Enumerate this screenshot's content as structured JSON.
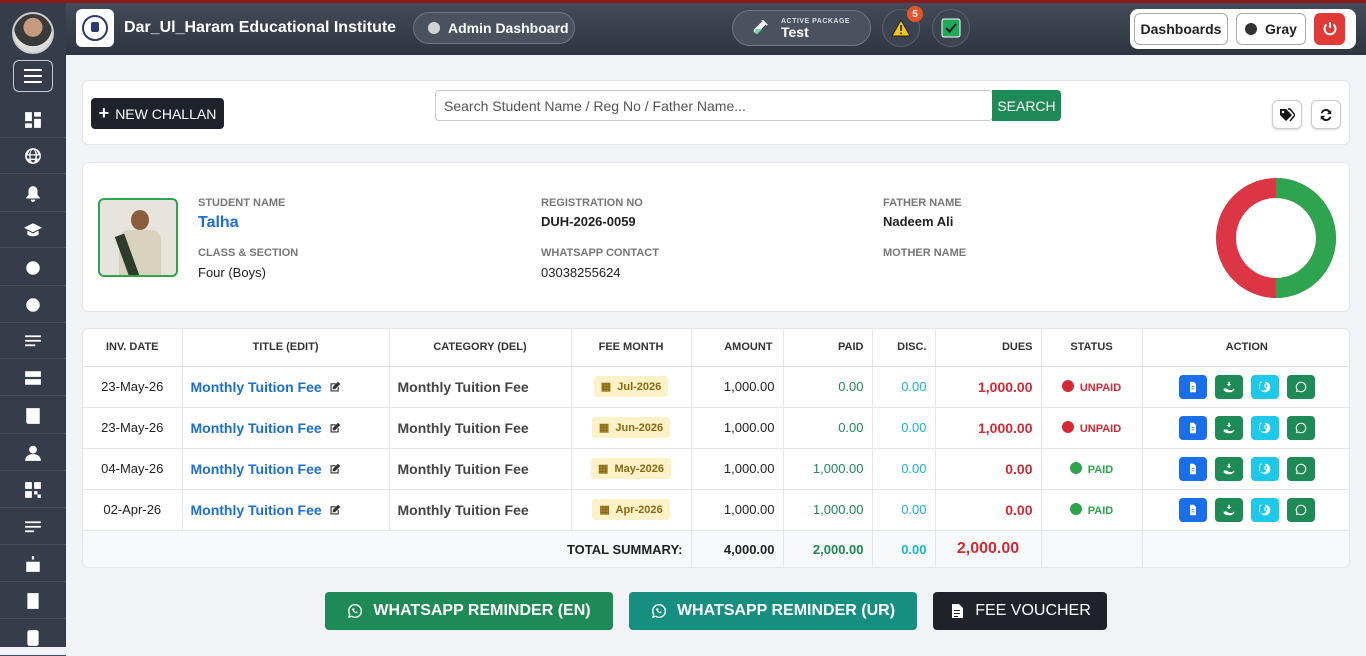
{
  "topbar": {
    "brand": "Dar_Ul_Haram Educational Institute",
    "admin_label": "Admin Dashboard",
    "package_caption": "ACTIVE PACKAGE",
    "package_name": "Test",
    "alert_count": "5",
    "dashboards_label": "Dashboards",
    "theme_label": "Gray"
  },
  "toolbar": {
    "new_challan_label": "NEW CHALLAN",
    "search_placeholder": "Search Student Name / Reg No / Father Name...",
    "search_button": "SEARCH"
  },
  "student": {
    "name_label": "STUDENT NAME",
    "name": "Talha",
    "class_label": "CLASS & SECTION",
    "class": "Four (Boys)",
    "reg_label": "REGISTRATION NO",
    "reg_no": "DUH-2026-0059",
    "whatsapp_label": "WHATSAPP CONTACT",
    "whatsapp": "03038255624",
    "father_label": "FATHER NAME",
    "father": "Nadeem Ali",
    "mother_label": "MOTHER NAME",
    "donut": {
      "paid": 2000,
      "dues": 2000,
      "paid_color": "#2ea44f",
      "dues_color": "#dc3545"
    }
  },
  "table": {
    "headers": [
      "INV. DATE",
      "TITLE (EDIT)",
      "CATEGORY (DEL)",
      "FEE MONTH",
      "AMOUNT",
      "PAID",
      "DISC.",
      "DUES",
      "STATUS",
      "ACTION"
    ],
    "rows": [
      {
        "date": "23-May-26",
        "title": "Monthly Tuition Fee",
        "category": "Monthly Tuition Fee",
        "month": "Jul-2026",
        "amount": "1,000.00",
        "paid": "0.00",
        "disc": "0.00",
        "dues": "1,000.00",
        "status": "UNPAID"
      },
      {
        "date": "23-May-26",
        "title": "Monthly Tuition Fee",
        "category": "Monthly Tuition Fee",
        "month": "Jun-2026",
        "amount": "1,000.00",
        "paid": "0.00",
        "disc": "0.00",
        "dues": "1,000.00",
        "status": "UNPAID"
      },
      {
        "date": "04-May-26",
        "title": "Monthly Tuition Fee",
        "category": "Monthly Tuition Fee",
        "month": "May-2026",
        "amount": "1,000.00",
        "paid": "1,000.00",
        "disc": "0.00",
        "dues": "0.00",
        "status": "PAID"
      },
      {
        "date": "02-Apr-26",
        "title": "Monthly Tuition Fee",
        "category": "Monthly Tuition Fee",
        "month": "Apr-2026",
        "amount": "1,000.00",
        "paid": "1,000.00",
        "disc": "0.00",
        "dues": "0.00",
        "status": "PAID"
      }
    ],
    "summary": {
      "label": "TOTAL SUMMARY:",
      "amount": "4,000.00",
      "paid": "2,000.00",
      "disc": "0.00",
      "dues": "2,000.00"
    }
  },
  "buttons": {
    "wa_en": "WHATSAPP REMINDER (EN)",
    "wa_ur": "WHATSAPP REMINDER (UR)",
    "voucher": "FEE VOUCHER"
  }
}
